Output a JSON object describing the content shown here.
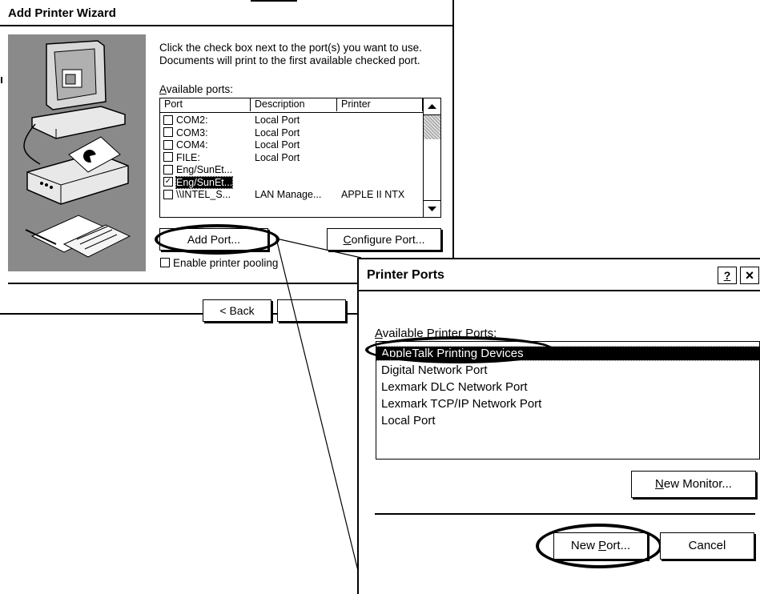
{
  "wizard": {
    "title": "Add Printer Wizard",
    "instruction_line1": "Click the check box next to the port(s) you want to use.",
    "instruction_line2": "Documents will print to the first available checked port.",
    "available_ports_label": "Available ports:",
    "columns": [
      "Port",
      "Description",
      "Printer"
    ],
    "ports": [
      {
        "port": "COM2:",
        "description": "Local Port",
        "printer": "",
        "checked": false,
        "selected": false
      },
      {
        "port": "COM3:",
        "description": "Local Port",
        "printer": "",
        "checked": false,
        "selected": false
      },
      {
        "port": "COM4:",
        "description": "Local Port",
        "printer": "",
        "checked": false,
        "selected": false
      },
      {
        "port": "FILE:",
        "description": "Local Port",
        "printer": "",
        "checked": false,
        "selected": false
      },
      {
        "port": "Eng/SunEt...",
        "description": "",
        "printer": "",
        "checked": false,
        "selected": false
      },
      {
        "port": "Eng/SunEt...",
        "description": "",
        "printer": "",
        "checked": true,
        "selected": true
      },
      {
        "port": "\\\\INTEL_S...",
        "description": "LAN Manage...",
        "printer": "APPLE II NTX",
        "checked": false,
        "selected": false
      }
    ],
    "add_port_label": "Add Port...",
    "configure_port_label": "Configure Port...",
    "enable_pooling_label": "Enable printer pooling",
    "back_label": "< Back"
  },
  "printer_ports": {
    "title": "Printer Ports",
    "help_label": "?",
    "close_label": "×",
    "available_label": "Available Printer Ports:",
    "items": [
      "AppleTalk Printing Devices",
      "Digital Network Port",
      "Lexmark DLC Network Port",
      "Lexmark TCP/IP Network Port",
      "Local Port"
    ],
    "selected_index": 0,
    "new_monitor_label": "New Monitor...",
    "new_port_label": "New Port...",
    "cancel_label": "Cancel"
  }
}
